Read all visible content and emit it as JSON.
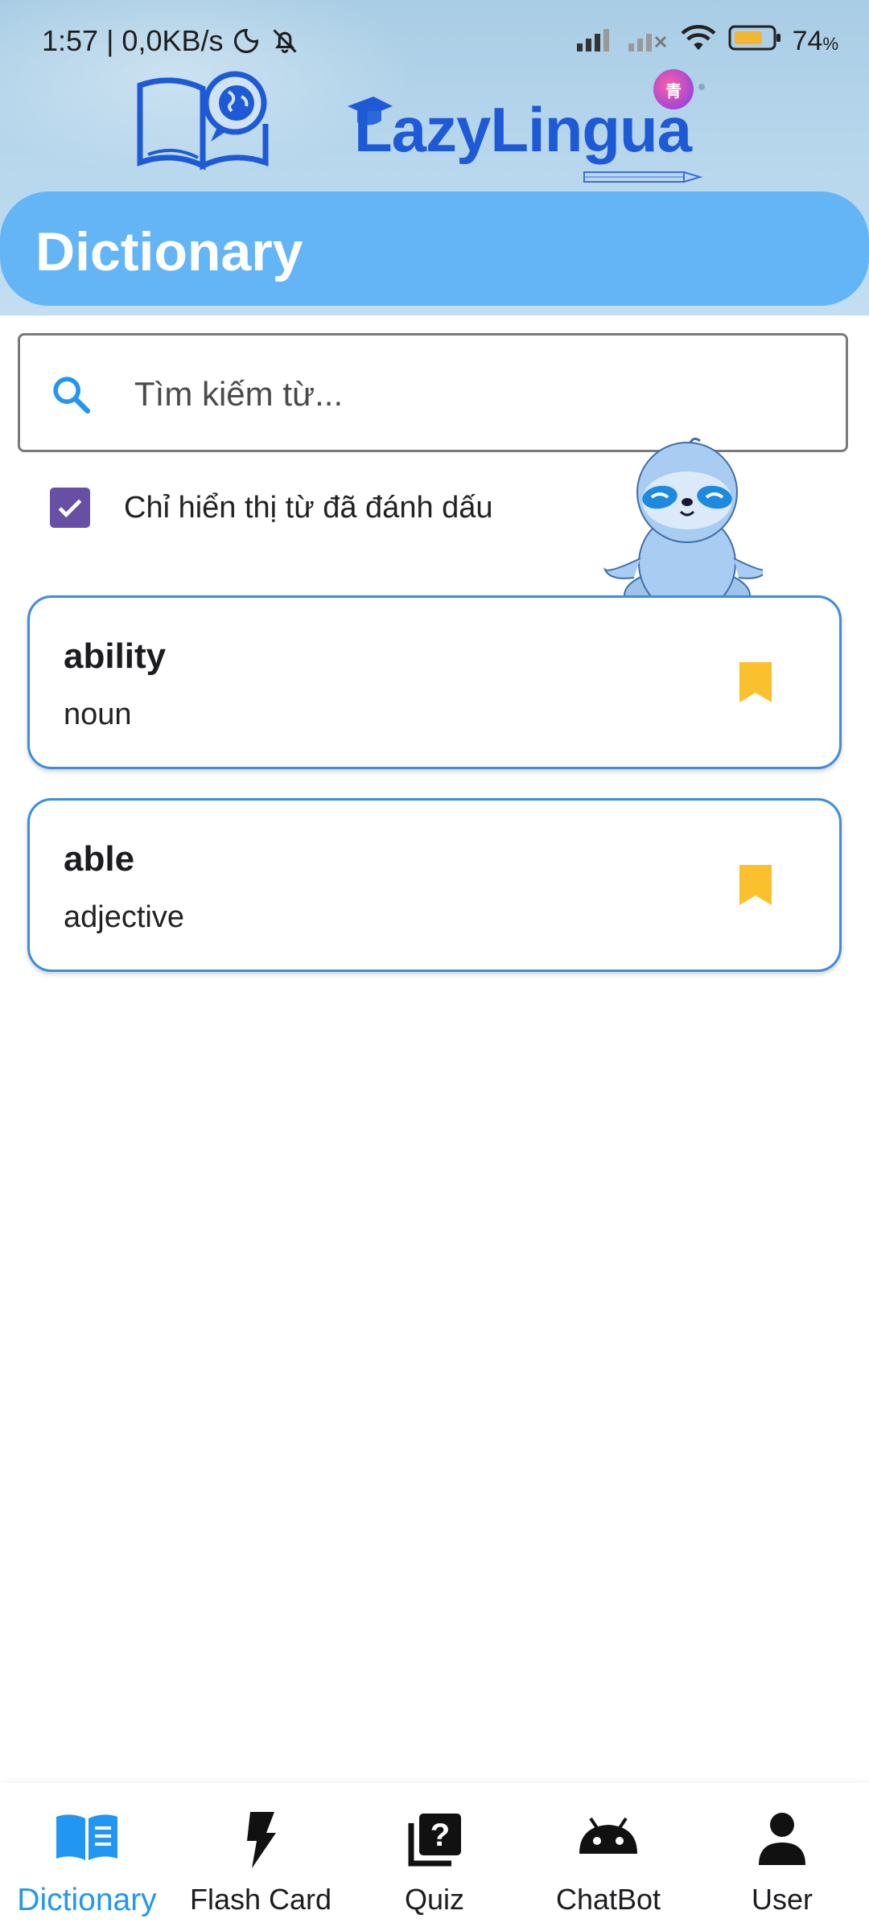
{
  "status_bar": {
    "time_speed": "1:57 | 0,0KB/s",
    "battery_percent": "74",
    "battery_symbol": "%"
  },
  "app": {
    "logo_text": "LazyLingua",
    "chip_text": "青"
  },
  "page": {
    "title": "Dictionary"
  },
  "search": {
    "placeholder": "Tìm kiếm từ..."
  },
  "filter": {
    "label": "Chỉ hiển thị từ đã đánh dấu",
    "checked": true
  },
  "words": [
    {
      "word": "ability",
      "pos": "noun",
      "bookmarked": true
    },
    {
      "word": "able",
      "pos": "adjective",
      "bookmarked": true
    }
  ],
  "nav": {
    "items": [
      {
        "label": "Dictionary",
        "icon": "book-icon",
        "active": true
      },
      {
        "label": "Flash Card",
        "icon": "flash-icon",
        "active": false
      },
      {
        "label": "Quiz",
        "icon": "quiz-icon",
        "active": false
      },
      {
        "label": "ChatBot",
        "icon": "android-icon",
        "active": false
      },
      {
        "label": "User",
        "icon": "person-icon",
        "active": false
      }
    ]
  },
  "colors": {
    "accent": "#2196f3",
    "title_bar": "#64b5f6",
    "checkbox": "#6750a4",
    "bookmark": "#fbc02d",
    "card_border": "#3d8ddc"
  }
}
